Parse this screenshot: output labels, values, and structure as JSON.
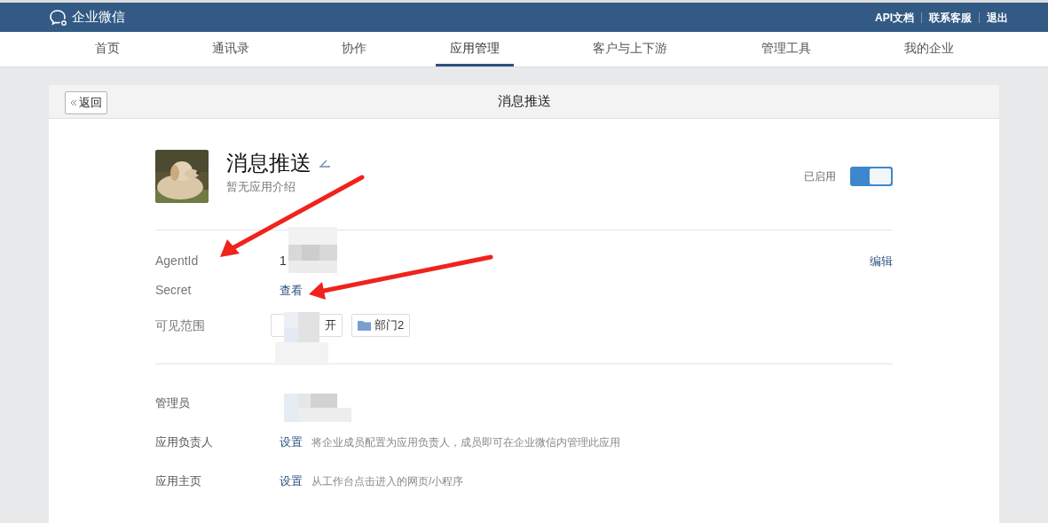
{
  "header": {
    "brand": "企业微信",
    "links": [
      "API文档",
      "联系客服",
      "退出"
    ]
  },
  "nav": [
    {
      "label": "首页",
      "selected": false
    },
    {
      "label": "通讯录",
      "selected": false
    },
    {
      "label": "协作",
      "selected": false
    },
    {
      "label": "应用管理",
      "selected": true
    },
    {
      "label": "客户与上下游",
      "selected": false
    },
    {
      "label": "管理工具",
      "selected": false
    },
    {
      "label": "我的企业",
      "selected": false
    }
  ],
  "panel": {
    "back_button": "返回",
    "title": "消息推送"
  },
  "app": {
    "name": "消息推送",
    "description": "暂无应用介绍",
    "status_label": "已启用",
    "on": true
  },
  "details": {
    "agent_id_label": "AgentId",
    "agent_id": "1",
    "edit_link": "编辑",
    "secret_label": "Secret",
    "secret_link": "查看",
    "scope_label": "可见范围",
    "scope_tags": [
      "开",
      "部门2"
    ]
  },
  "settings": [
    {
      "label": "管理员"
    },
    {
      "label": "应用负责人",
      "link": "设置",
      "hint": "将企业成员配置为应用负责人，成员即可在企业微信内管理此应用"
    },
    {
      "label": "应用主页",
      "link": "设置",
      "hint": "从工作台点击进入的网页/小程序"
    }
  ]
}
